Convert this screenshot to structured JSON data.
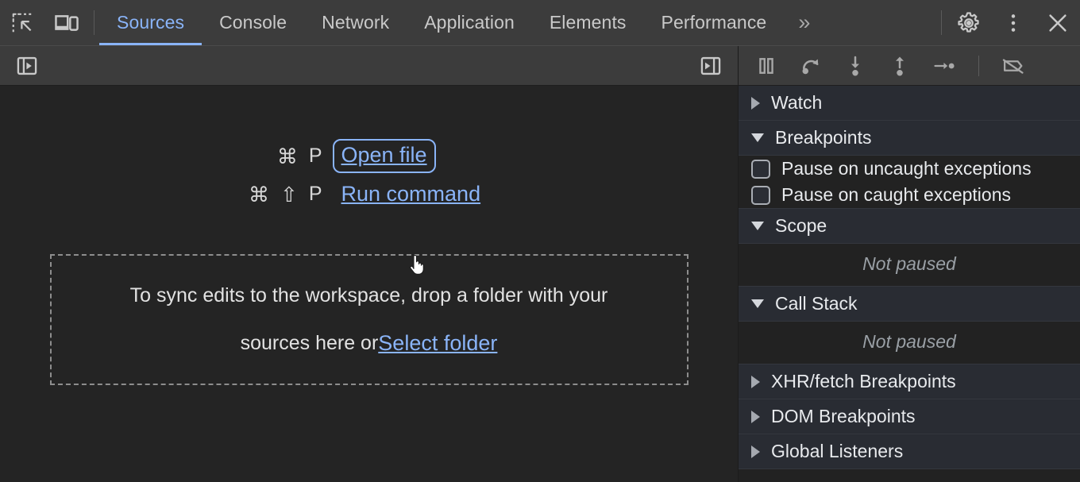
{
  "toolbar": {
    "inspect_icon": "inspect-element-icon",
    "device_icon": "device-toolbar-icon",
    "tabs": [
      {
        "label": "Sources",
        "active": true
      },
      {
        "label": "Console",
        "active": false
      },
      {
        "label": "Network",
        "active": false
      },
      {
        "label": "Application",
        "active": false
      },
      {
        "label": "Elements",
        "active": false
      },
      {
        "label": "Performance",
        "active": false
      }
    ],
    "more_tabs_label": "»",
    "settings_icon": "gear-icon",
    "menu_icon": "kebab-menu-icon",
    "close_icon": "close-icon",
    "accent_color": "#8ab4f8"
  },
  "navigator_bar": {
    "show_navigator_icon": "show-navigator-panel-icon",
    "show_debugger_icon": "show-debugger-panel-icon"
  },
  "editor": {
    "shortcuts": [
      {
        "keys": [
          "⌘",
          "P"
        ],
        "action_label": "Open file",
        "focused": true
      },
      {
        "keys": [
          "⌘",
          "⇧",
          "P"
        ],
        "action_label": "Run command",
        "focused": false
      }
    ],
    "dropzone": {
      "line1": "To sync edits to the workspace, drop a folder with your",
      "line2_prefix": "sources here or ",
      "line2_link": "Select folder"
    }
  },
  "debugger_toolbar": {
    "buttons": [
      {
        "name": "pause-script-execution-icon",
        "title": "Pause script execution"
      },
      {
        "name": "step-over-icon",
        "title": "Step over next function call"
      },
      {
        "name": "step-into-icon",
        "title": "Step into next function call"
      },
      {
        "name": "step-out-icon",
        "title": "Step out of current function"
      },
      {
        "name": "step-icon",
        "title": "Step"
      },
      {
        "name": "deactivate-breakpoints-icon",
        "title": "Deactivate breakpoints"
      }
    ]
  },
  "sidebar": {
    "sections": [
      {
        "label": "Watch",
        "expanded": false
      },
      {
        "label": "Breakpoints",
        "expanded": true
      },
      {
        "label": "Scope",
        "expanded": true
      },
      {
        "label": "Call Stack",
        "expanded": true
      },
      {
        "label": "XHR/fetch Breakpoints",
        "expanded": false
      },
      {
        "label": "DOM Breakpoints",
        "expanded": false
      },
      {
        "label": "Global Listeners",
        "expanded": false
      }
    ],
    "breakpoint_options": [
      {
        "label": "Pause on uncaught exceptions",
        "checked": false
      },
      {
        "label": "Pause on caught exceptions",
        "checked": false
      }
    ],
    "scope_status": "Not paused",
    "callstack_status": "Not paused"
  }
}
